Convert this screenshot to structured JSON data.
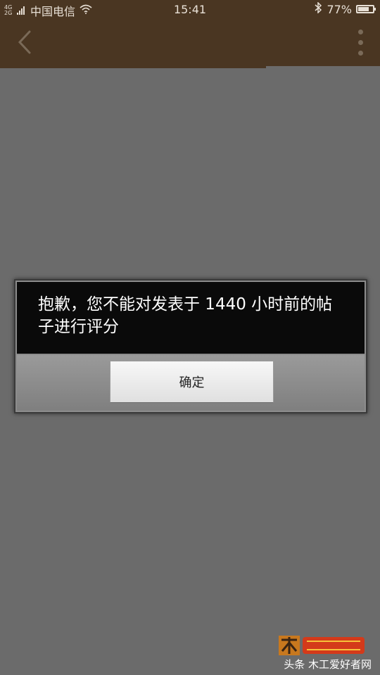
{
  "status_bar": {
    "network_type": "4G 2G",
    "carrier": "中国电信",
    "time": "15:41",
    "battery_percent": "77%",
    "battery_level": 0.77,
    "icons": [
      "signal-icon",
      "wifi-icon",
      "bluetooth-icon",
      "battery-icon"
    ]
  },
  "app_bar": {
    "background": "#4a3622",
    "icons": [
      "back-arrow-icon",
      "overflow-menu-icon"
    ],
    "loading_progress": 0.7
  },
  "dialog": {
    "message": "抱歉，您不能对发表于 1440 小时前的帖子进行评分",
    "ok_label": "确定"
  },
  "watermark": {
    "logo_text": "木工爱好者",
    "caption": "头条 木工爱好者网"
  }
}
